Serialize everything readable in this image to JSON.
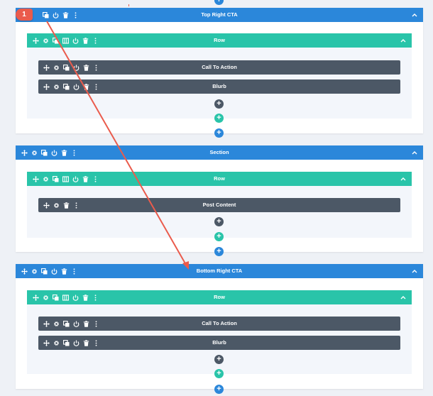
{
  "colors": {
    "section": "#2b87da",
    "row": "#29c4a9",
    "module": "#4c5866",
    "arrow": "#ea5b4c"
  },
  "annotation": {
    "step": "1"
  },
  "sections": [
    {
      "title": "Top Right CTA",
      "icons": [
        "copy-icon",
        "power-icon",
        "trash-icon",
        "more-icon"
      ],
      "row": {
        "title": "Row",
        "modules": [
          "Call To Action",
          "Blurb"
        ]
      }
    },
    {
      "title": "Section",
      "icons": [
        "move-icon",
        "gear-icon",
        "copy-icon",
        "power-icon",
        "trash-icon",
        "more-icon"
      ],
      "row": {
        "title": "Row",
        "modules": [
          "Post Content"
        ]
      }
    },
    {
      "title": "Bottom Right CTA",
      "icons": [
        "move-icon",
        "gear-icon",
        "copy-icon",
        "power-icon",
        "trash-icon",
        "more-icon"
      ],
      "row": {
        "title": "Row",
        "modules": [
          "Call To Action",
          "Blurb"
        ]
      }
    }
  ],
  "add_symbol": "+"
}
